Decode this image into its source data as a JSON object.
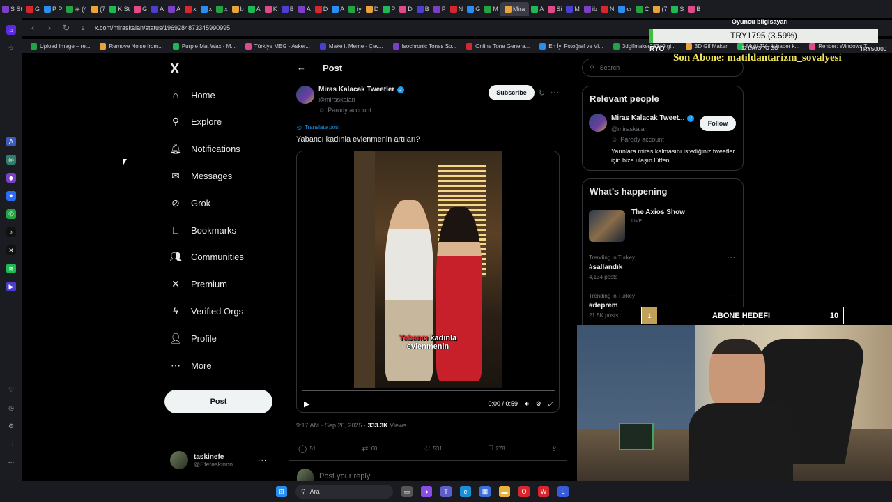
{
  "browser": {
    "tabs": [
      "S St",
      "G",
      "P P",
      "⎈ (4",
      "(7",
      "K St",
      "G",
      "A",
      "A",
      "x",
      "x",
      "x",
      "b",
      "A",
      "K",
      "B",
      "A",
      "D",
      "A",
      "iy",
      "D",
      "P",
      "D",
      "B",
      "P",
      "N",
      "G",
      "M",
      "Mira",
      "A",
      "Si",
      "M",
      "ib",
      "N",
      "cr",
      "C",
      "(7",
      "S",
      "B"
    ],
    "active_tab": "Mira",
    "url": "x.com/miraskalan/status/1969284873345990995",
    "bookmarks": [
      "Upload Image – re...",
      "Remove Noise from...",
      "Purple Mat Wax - M...",
      "Türkiye MEG - Asker...",
      "Make it Meme - Çev...",
      "Isochronic Tones So...",
      "Online Tone Genera...",
      "En İyi Fotoğraf ve Vi...",
      "3dgifmaker28349.gi...",
      "3D Gif Maker",
      "Multi TV - b.haber k...",
      "Rehber: Windows T..."
    ]
  },
  "nav": {
    "logo": "X",
    "items": [
      "Home",
      "Explore",
      "Notifications",
      "Messages",
      "Grok",
      "Bookmarks",
      "Communities",
      "Premium",
      "Verified Orgs",
      "Profile",
      "More"
    ],
    "post_label": "Post",
    "account_name": "taskinefe",
    "account_handle": "@Efetaskinnn",
    "account_more": "···"
  },
  "post": {
    "back": "←",
    "header": "Post",
    "author_name": "Miras Kalacak Tweetler",
    "author_handle": "@miraskalan",
    "parody": "Parody account",
    "subscribe": "Subscribe",
    "translate": "Translate post",
    "text": "Yabancı kadınla evlenmenin artıları?",
    "caption_red": "Yabancı",
    "caption_white1": "kadınla",
    "caption_white2": "evlenmenin",
    "time": "0:00 / 0:59",
    "timestamp": "9:17 AM · Sep 20, 2025 · ",
    "views_count": "333.3K",
    "views_label": "Views",
    "replies": "51",
    "reposts": "60",
    "likes": "531",
    "bookmarks": "278",
    "reply_placeholder": "Post your reply"
  },
  "right": {
    "search_placeholder": "Search",
    "relevant_title": "Relevant people",
    "person_name": "Miras Kalacak Tweet...",
    "person_handle": "@miraskalan",
    "person_parody": "Parody account",
    "person_bio": "Yarınlara miras kalmasını istediğiniz tweetler için bize ulaşın lütfen.",
    "follow": "Follow",
    "happening_title": "What’s happening",
    "show_title": "The Axios Show",
    "show_live": "LIVE",
    "trends": [
      {
        "context": "Trending in Turkey",
        "name": "#sallandık",
        "posts": "4,134 posts"
      },
      {
        "context": "Trending in Turkey",
        "name": "#deprem",
        "posts": "21.5K posts"
      }
    ]
  },
  "stream": {
    "oyuncu": "Oyuncu bilgisayarı",
    "price": "TRY1795 (3.59%)",
    "ryo": "RYO",
    "days": "12 DAYS TO GO",
    "target": "TRY50000",
    "son_abone": "Son Abone: matildantarizm_sovalyesi",
    "goal_current": "1",
    "goal_title": "ABONE HEDEFI",
    "goal_target": "10",
    "goal_progress": 0.1
  },
  "taskbar": {
    "search": "Ara"
  }
}
